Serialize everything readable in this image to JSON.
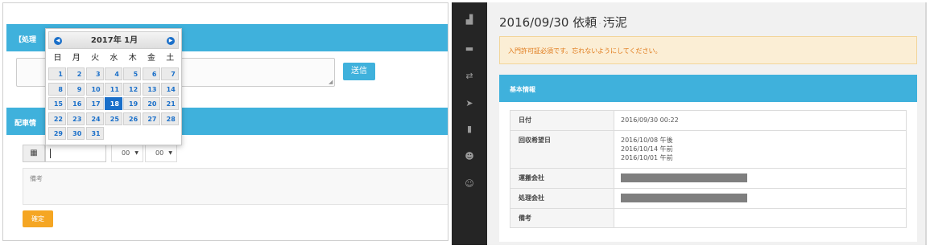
{
  "left": {
    "panel1_header": "【処理",
    "send_label": "送信",
    "panel2_header": "配車情",
    "calendar_icon": "calendar-icon",
    "date_value": "",
    "hour_value": "00",
    "minute_value": "00",
    "remarks_placeholder": "備考",
    "confirm_label": "確定",
    "datepicker": {
      "title": "2017年 1月",
      "prev_icon": "chevron-left-icon",
      "next_icon": "chevron-right-icon",
      "weekdays": [
        "日",
        "月",
        "火",
        "水",
        "木",
        "金",
        "土"
      ],
      "weeks": [
        [
          "1",
          "2",
          "3",
          "4",
          "5",
          "6",
          "7"
        ],
        [
          "8",
          "9",
          "10",
          "11",
          "12",
          "13",
          "14"
        ],
        [
          "15",
          "16",
          "17",
          "18",
          "19",
          "20",
          "21"
        ],
        [
          "22",
          "23",
          "24",
          "25",
          "26",
          "27",
          "28"
        ],
        [
          "29",
          "30",
          "31"
        ]
      ],
      "selected_day": "18",
      "selected_color": "#1a6fc9"
    }
  },
  "right": {
    "sidebar_icons": [
      "factory-icon",
      "truck-icon",
      "transfer-icon",
      "send-icon",
      "building-icon",
      "users-icon",
      "add-user-icon"
    ],
    "title_main": "2016/09/30 依頼",
    "title_separator": "·",
    "title_sub": "汚泥",
    "alert": "入門許可証必須です。忘れないようにしてください。",
    "panel_header": "基本情報",
    "rows": [
      {
        "label": "日付",
        "values": [
          "2016/09/30 00:22"
        ]
      },
      {
        "label": "回収希望日",
        "values": [
          "2016/10/08 午後",
          "2016/10/14 午前",
          "2016/10/01 午前"
        ]
      },
      {
        "label": "運搬会社",
        "values": [],
        "redacted": true
      },
      {
        "label": "処理会社",
        "values": [],
        "redacted": true
      },
      {
        "label": "備考",
        "values": []
      }
    ],
    "accent_color": "#3fb1dc"
  }
}
